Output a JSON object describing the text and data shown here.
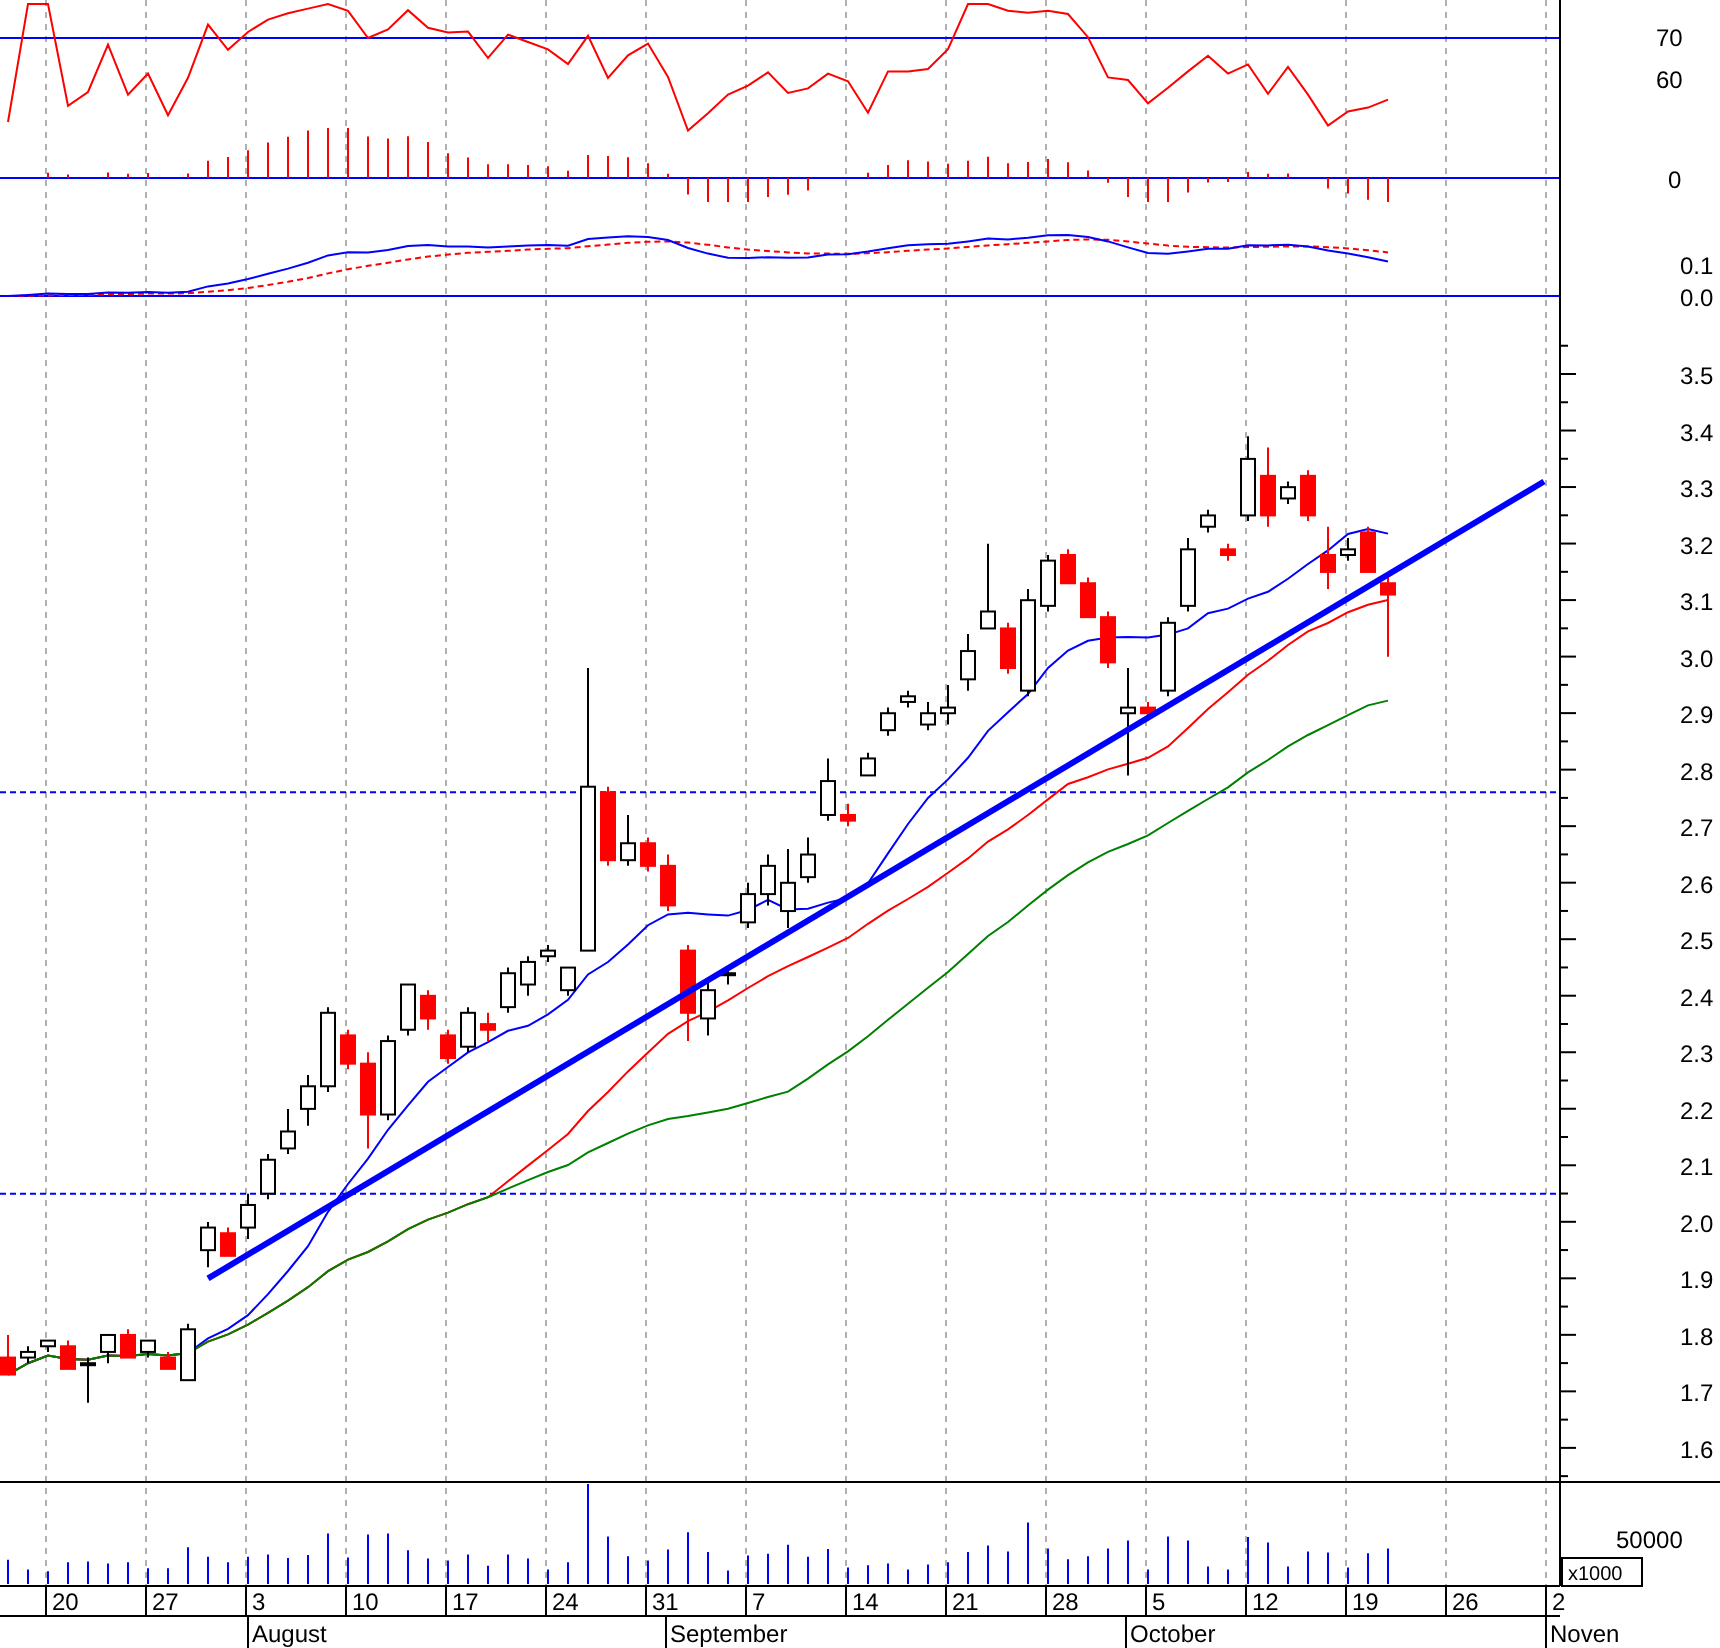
{
  "rsi_panel": {
    "ticks": [
      "70",
      "60"
    ]
  },
  "macd_panel": {
    "ticks": [
      "0",
      "0.1",
      "0.0"
    ]
  },
  "price_axis": {
    "ticks": [
      "3.5",
      "3.4",
      "3.3",
      "3.2",
      "3.1",
      "3.0",
      "2.9",
      "2.8",
      "2.7",
      "2.6",
      "2.5",
      "2.4",
      "2.3",
      "2.2",
      "2.1",
      "2.0",
      "1.9",
      "1.8",
      "1.7",
      "1.6"
    ]
  },
  "volume_panel": {
    "tick": "50000",
    "unit": "x1000"
  },
  "date_axis": {
    "days": [
      "20",
      "27",
      "3",
      "10",
      "17",
      "24",
      "31",
      "7",
      "14",
      "21",
      "28",
      "5",
      "12",
      "19",
      "26",
      "2"
    ],
    "months": [
      "August",
      "September",
      "October",
      "Noven"
    ]
  }
}
